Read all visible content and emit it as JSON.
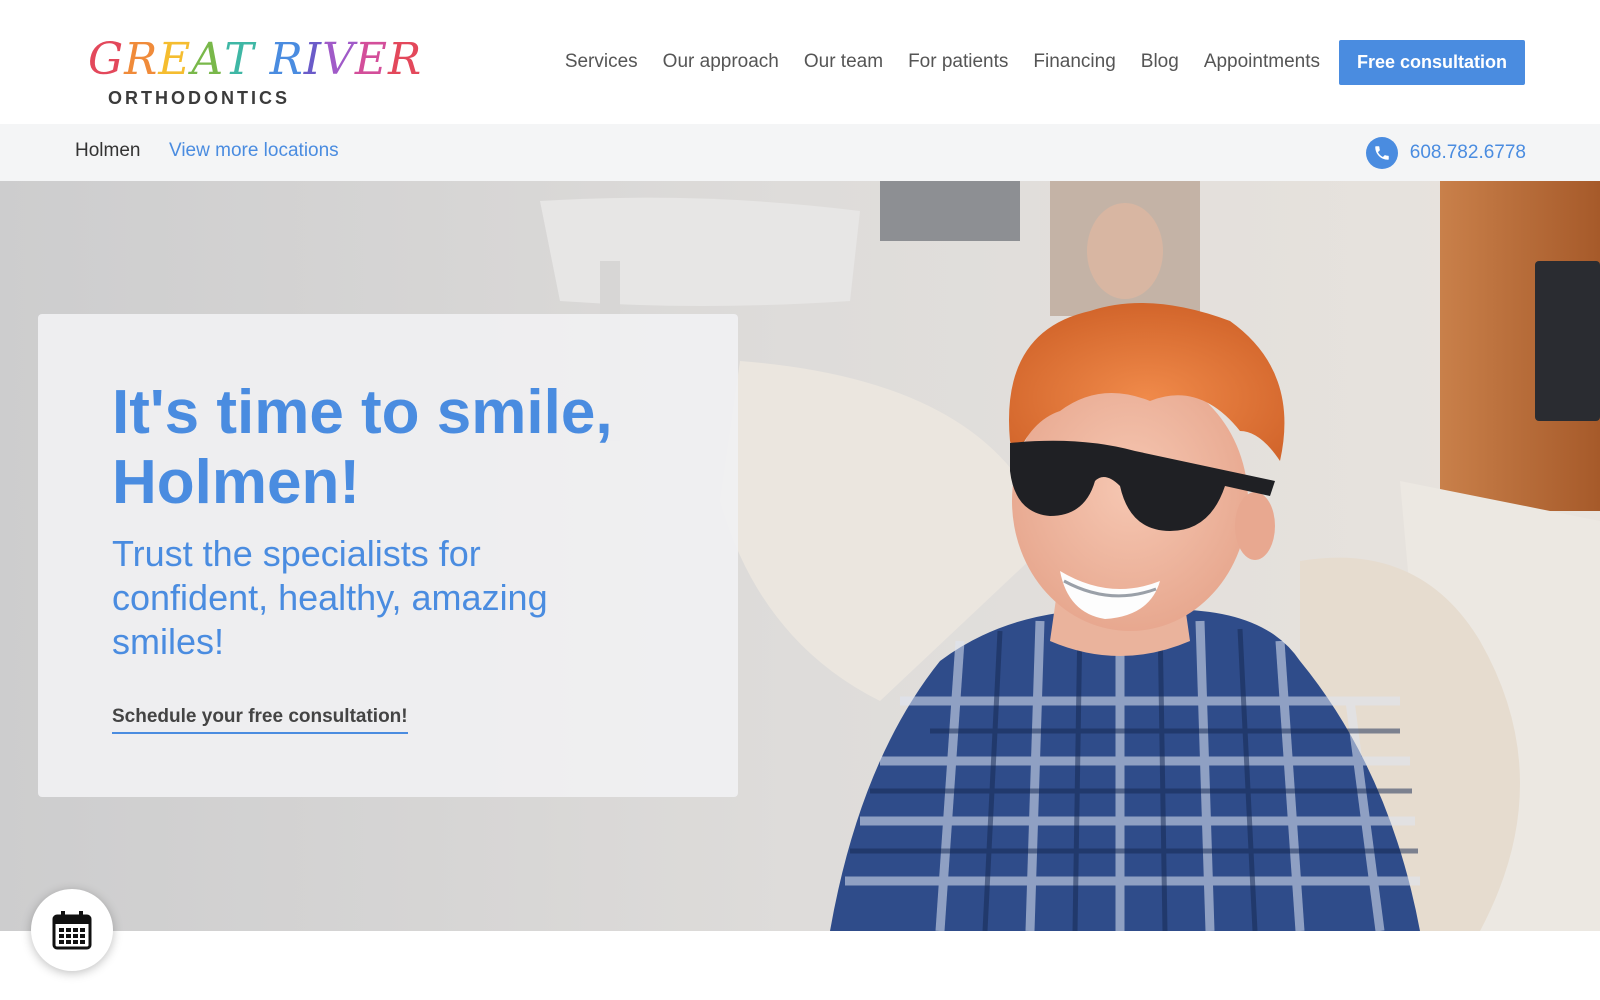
{
  "brand": {
    "logo_top_letters": [
      "G",
      "R",
      "E",
      "A",
      "T",
      " ",
      "R",
      "I",
      "V",
      "E",
      "R"
    ],
    "logo_top_colors": [
      "#e3485b",
      "#f08b3a",
      "#f5bd2f",
      "#79b84a",
      "#3fb7a5",
      "#ffffff",
      "#4a8ce0",
      "#6a5bc9",
      "#a05ac8",
      "#d34e9a",
      "#e3485b"
    ],
    "logo_bottom": "ORTHODONTICS"
  },
  "nav": {
    "items": [
      "Services",
      "Our approach",
      "Our team",
      "For patients",
      "Financing",
      "Blog",
      "Appointments"
    ],
    "cta_label": "Free consultation"
  },
  "location_bar": {
    "current": "Holmen",
    "more_link": "View more locations",
    "phone": "608.782.6778",
    "phone_icon": "phone-icon"
  },
  "hero": {
    "title": "It's time to smile, Holmen!",
    "subtitle": "Trust the specialists for confident, healthy, amazing smiles!",
    "link": "Schedule your free consultation!",
    "image_alt": "smiling-teen-with-braces-and-sunglasses-photo"
  },
  "floating": {
    "icon": "calendar-icon"
  },
  "colors": {
    "accent": "#4a8ce0",
    "text": "#555555",
    "bar_bg": "#f4f5f6"
  }
}
